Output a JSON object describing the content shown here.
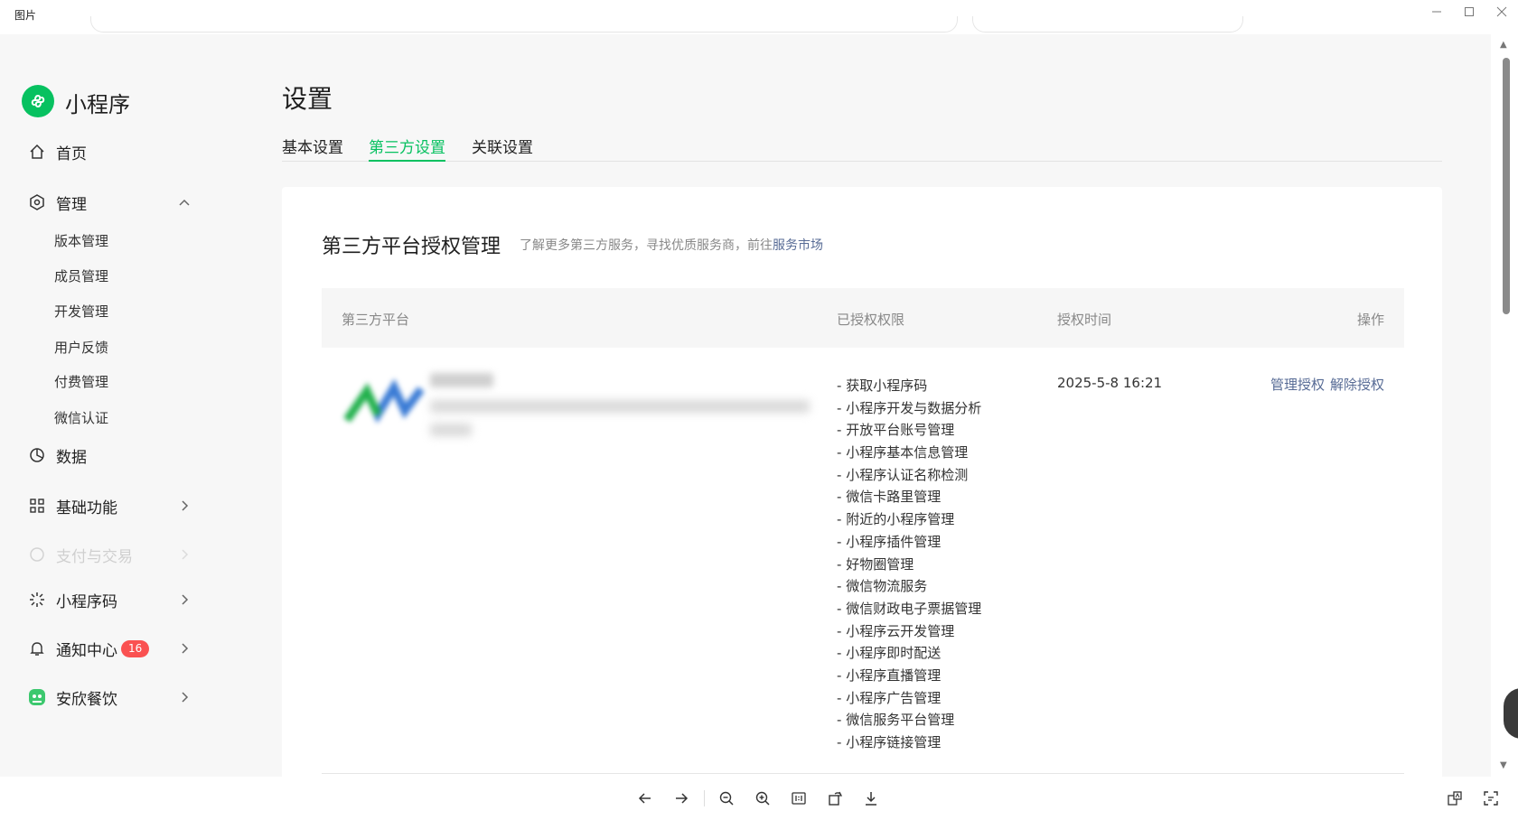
{
  "window": {
    "title": "图片"
  },
  "sidebar": {
    "brand": "小程序",
    "home": "首页",
    "manage": "管理",
    "manage_items": [
      "版本管理",
      "成员管理",
      "开发管理",
      "用户反馈",
      "付费管理",
      "微信认证"
    ],
    "data": "数据",
    "basic_functions": "基础功能",
    "payment": "支付与交易",
    "mini_code": "小程序码",
    "notifications": "通知中心",
    "notification_count": "16",
    "account_name": "安欣餐饮"
  },
  "main": {
    "title": "设置",
    "tabs": [
      {
        "label": "基本设置",
        "active": false
      },
      {
        "label": "第三方设置",
        "active": true
      },
      {
        "label": "关联设置",
        "active": false
      }
    ],
    "card": {
      "title": "第三方平台授权管理",
      "subtitle": "了解更多第三方服务，寻找优质服务商，前往",
      "subtitle_link": "服务市场",
      "columns": [
        "第三方平台",
        "已授权权限",
        "授权时间",
        "操作"
      ],
      "row": {
        "permissions": [
          "获取小程序码",
          "小程序开发与数据分析",
          "开放平台账号管理",
          "小程序基本信息管理",
          "小程序认证名称检测",
          "微信卡路里管理",
          "附近的小程序管理",
          "小程序插件管理",
          "好物圈管理",
          "微信物流服务",
          "微信财政电子票据管理",
          "小程序云开发管理",
          "小程序即时配送",
          "小程序直播管理",
          "小程序广告管理",
          "微信服务平台管理",
          "小程序链接管理"
        ],
        "auth_time": "2025-5-8 16:21",
        "actions": [
          "管理授权",
          "解除授权"
        ]
      }
    }
  },
  "colors": {
    "accent": "#07c160",
    "link": "#576b95",
    "badge": "#fa5151"
  }
}
